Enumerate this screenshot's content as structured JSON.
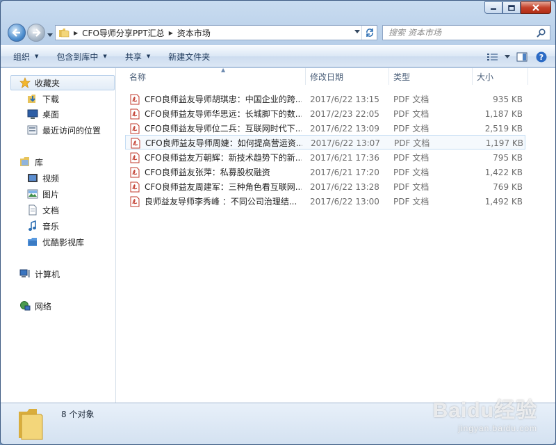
{
  "window": {
    "caption": {
      "minimize": "minimize",
      "maximize": "maximize",
      "close": "close"
    }
  },
  "address": {
    "crumbs": [
      "CFO导师分享PPT汇总",
      "资本市场"
    ]
  },
  "search": {
    "placeholder": "搜索 资本市场"
  },
  "toolbar": {
    "organize": "组织",
    "include_in_library": "包含到库中",
    "share": "共享",
    "new_folder": "新建文件夹"
  },
  "sidebar": {
    "favorites": "收藏夹",
    "downloads": "下载",
    "desktop": "桌面",
    "recent": "最近访问的位置",
    "libraries": "库",
    "videos": "视频",
    "pictures": "图片",
    "documents": "文档",
    "music": "音乐",
    "youku": "优酷影视库",
    "computer": "计算机",
    "network": "网络"
  },
  "columns": {
    "name": "名称",
    "modified": "修改日期",
    "type": "类型",
    "size": "大小"
  },
  "files": [
    {
      "name": "CFO良师益友导师胡琪忠：中国企业的跨...",
      "date": "2017/6/22 13:15",
      "type": "PDF 文档",
      "size": "935 KB"
    },
    {
      "name": "CFO良师益友导师华思远：长城脚下的数...",
      "date": "2017/2/23 22:05",
      "type": "PDF 文档",
      "size": "1,187 KB"
    },
    {
      "name": "CFO良师益友导师位二兵：互联网时代下...",
      "date": "2017/6/22 13:09",
      "type": "PDF 文档",
      "size": "2,519 KB"
    },
    {
      "name": "CFO良师益友导师周婕：如何提高营运资...",
      "date": "2017/6/22 13:07",
      "type": "PDF 文档",
      "size": "1,197 KB"
    },
    {
      "name": "CFO良师益友万朝辉：新技术趋势下的新...",
      "date": "2017/6/21 17:36",
      "type": "PDF 文档",
      "size": "795 KB"
    },
    {
      "name": "CFO良师益友张萍：私募股权融资",
      "date": "2017/6/21 17:20",
      "type": "PDF 文档",
      "size": "1,422 KB"
    },
    {
      "name": "CFO良师益友周建军：三种角色看互联网...",
      "date": "2017/6/22 13:28",
      "type": "PDF 文档",
      "size": "769 KB"
    },
    {
      "name": "良师益友导师李秀峰 ：不同公司治理结...",
      "date": "2017/6/22 13:00",
      "type": "PDF 文档",
      "size": "1,492 KB"
    }
  ],
  "details": {
    "count": "8 个对象"
  },
  "watermark": {
    "brand": "Baidu经验",
    "url": "jingyan.baidu.com"
  }
}
